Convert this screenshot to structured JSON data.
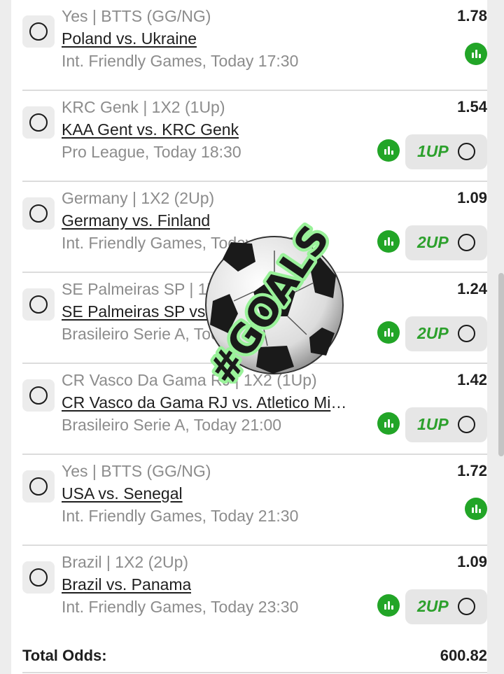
{
  "bets": [
    {
      "selection": "Yes | BTTS (GG/NG)",
      "match": "Poland vs. Ukraine",
      "competition": "Int. Friendly Games, Today 17:30",
      "odds": "1.78",
      "boost": ""
    },
    {
      "selection": "KRC Genk | 1X2 (1Up)",
      "match": "KAA Gent vs. KRC Genk",
      "competition": "Pro League, Today 18:30",
      "odds": "1.54",
      "boost": "1UP"
    },
    {
      "selection": "Germany | 1X2 (2Up)",
      "match": "Germany vs. Finland",
      "competition": "Int. Friendly Games, Today 19:45",
      "odds": "1.09",
      "boost": "2UP"
    },
    {
      "selection": "SE Palmeiras SP | 1X2 (2Up)",
      "match": "SE Palmeiras SP vs. Fortaleza EC",
      "competition": "Brasileiro Serie A, Today 20:00",
      "odds": "1.24",
      "boost": "2UP"
    },
    {
      "selection": "CR Vasco Da Gama RJ | 1X2 (1Up)",
      "match": "CR Vasco da Gama RJ vs. Atletico Mineiro",
      "competition": "Brasileiro Serie A, Today 21:00",
      "odds": "1.42",
      "boost": "1UP"
    },
    {
      "selection": "Yes | BTTS (GG/NG)",
      "match": "USA vs. Senegal",
      "competition": "Int. Friendly Games, Today 21:30",
      "odds": "1.72",
      "boost": ""
    },
    {
      "selection": "Brazil | 1X2 (2Up)",
      "match": "Brazil vs. Panama",
      "competition": "Int. Friendly Games, Today 23:30",
      "odds": "1.09",
      "boost": "2UP"
    }
  ],
  "total": {
    "label": "Total Odds:",
    "value": "600.82"
  },
  "sticker": {
    "text": "#GOALS",
    "icon": "soccer-ball-icon"
  },
  "colors": {
    "accent_green": "#22a527",
    "boost_text": "#2ca02c",
    "muted_text": "#8c8c8c"
  },
  "icons": {
    "select": "radio-circle-icon",
    "stats": "stats-bars-icon"
  }
}
